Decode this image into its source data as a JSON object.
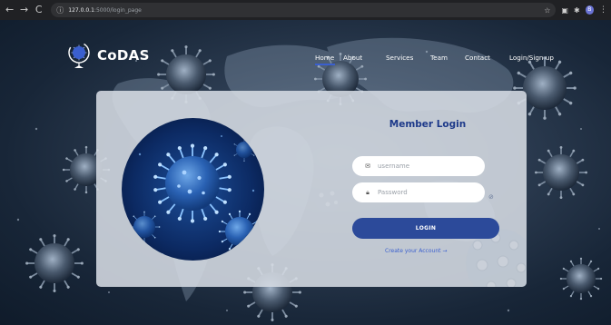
{
  "browser": {
    "url_host": "127.0.0.1",
    "url_path": ":5000/login_page",
    "profile_initial": "B",
    "back_icon": "arrow-left-icon",
    "forward_icon": "arrow-right-icon",
    "reload_icon": "reload-icon",
    "info_icon": "info-icon",
    "star_icon": "star-icon",
    "extension_icons": [
      "screen-icon",
      "puzzle-icon"
    ]
  },
  "brand": {
    "name": "CoDAS",
    "logo_icon": "globe-virus-logo-icon"
  },
  "nav": {
    "items": [
      {
        "label": "Home",
        "active": true
      },
      {
        "label": "About",
        "active": false
      },
      {
        "label": "Services",
        "active": false
      },
      {
        "label": "Team",
        "active": false
      },
      {
        "label": "Contact",
        "active": false
      },
      {
        "label": "Login/Sign up",
        "active": false
      }
    ]
  },
  "login": {
    "title": "Member Login",
    "username_placeholder": "username",
    "password_placeholder": "Password",
    "username_icon": "envelope-icon",
    "password_icon": "lock-icon",
    "eye_icon": "eye-slash-icon",
    "button_label": "LOGIN",
    "create_account_label": "Create your Account →"
  },
  "colors": {
    "accent": "#2c4a9a",
    "title": "#1e3a8a",
    "link": "#3a5fcf",
    "card": "#d6dce4"
  }
}
